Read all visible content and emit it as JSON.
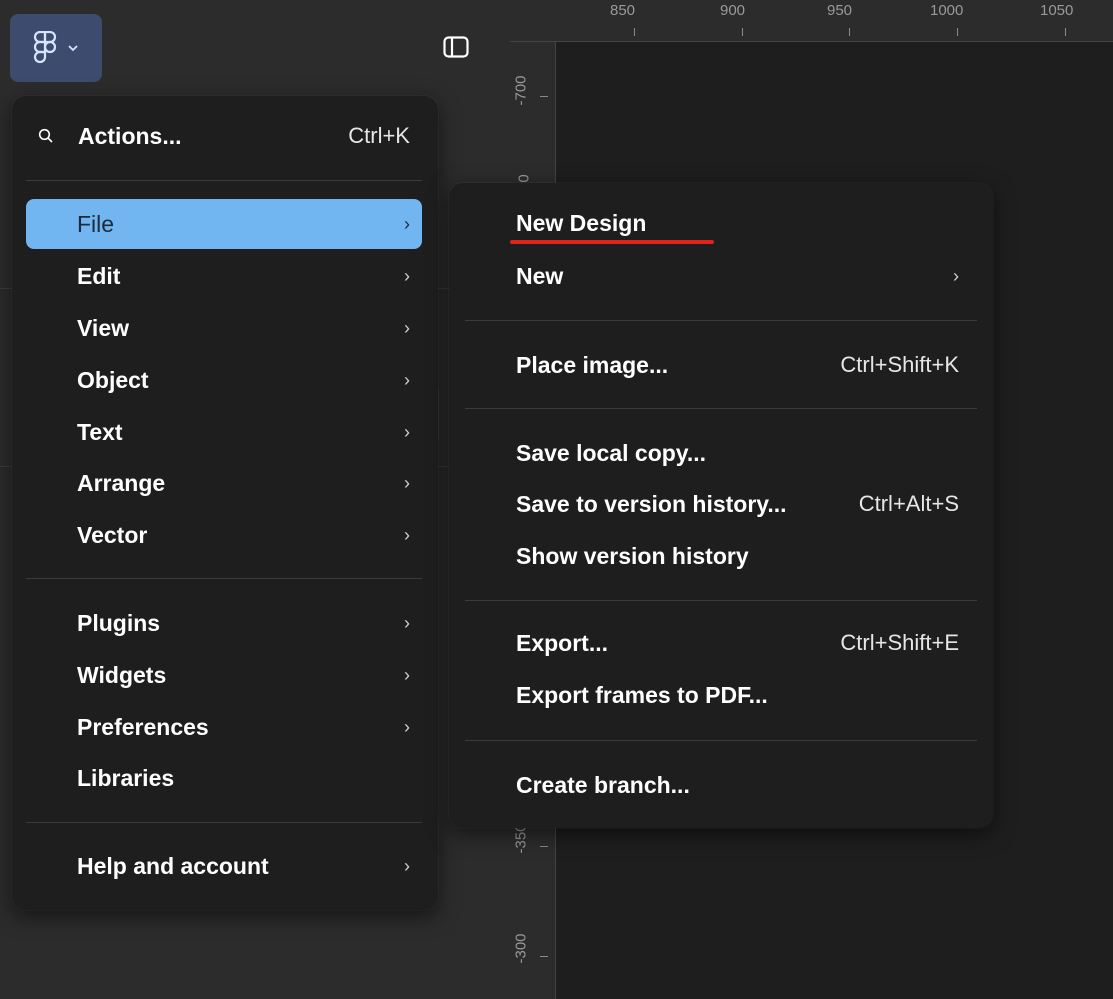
{
  "ruler": {
    "top_labels": [
      "850",
      "900",
      "950",
      "1000",
      "1050"
    ],
    "left_labels": [
      "-700",
      "0",
      "-350",
      "-300"
    ]
  },
  "main_menu": {
    "actions": {
      "label": "Actions...",
      "shortcut": "Ctrl+K"
    },
    "group1": [
      {
        "label": "File",
        "highlighted": true
      },
      {
        "label": "Edit"
      },
      {
        "label": "View"
      },
      {
        "label": "Object"
      },
      {
        "label": "Text"
      },
      {
        "label": "Arrange"
      },
      {
        "label": "Vector"
      }
    ],
    "group2": [
      {
        "label": "Plugins"
      },
      {
        "label": "Widgets"
      },
      {
        "label": "Preferences"
      },
      {
        "label": "Libraries"
      }
    ],
    "help": {
      "label": "Help and account"
    },
    "chevron": "›"
  },
  "file_submenu": {
    "new_design": "New Design",
    "new": "New",
    "place_image": {
      "label": "Place image...",
      "shortcut": "Ctrl+Shift+K"
    },
    "save_local_copy": "Save local copy...",
    "save_to_version_history": {
      "label": "Save to version history...",
      "shortcut": "Ctrl+Alt+S"
    },
    "show_version_history": "Show version history",
    "export": {
      "label": "Export...",
      "shortcut": "Ctrl+Shift+E"
    },
    "export_frames_pdf": "Export frames to PDF...",
    "create_branch": "Create branch..."
  },
  "colors": {
    "menu_bg": "#1e1e1e",
    "highlight": "#71b6f0",
    "annotation_underline": "#e0241b",
    "menu_button_bg": "#3d4b6e"
  },
  "icons": [
    "figma-logo-icon",
    "chevron-down-icon",
    "panel-toggle-icon",
    "search-icon",
    "chevron-right-icon"
  ]
}
